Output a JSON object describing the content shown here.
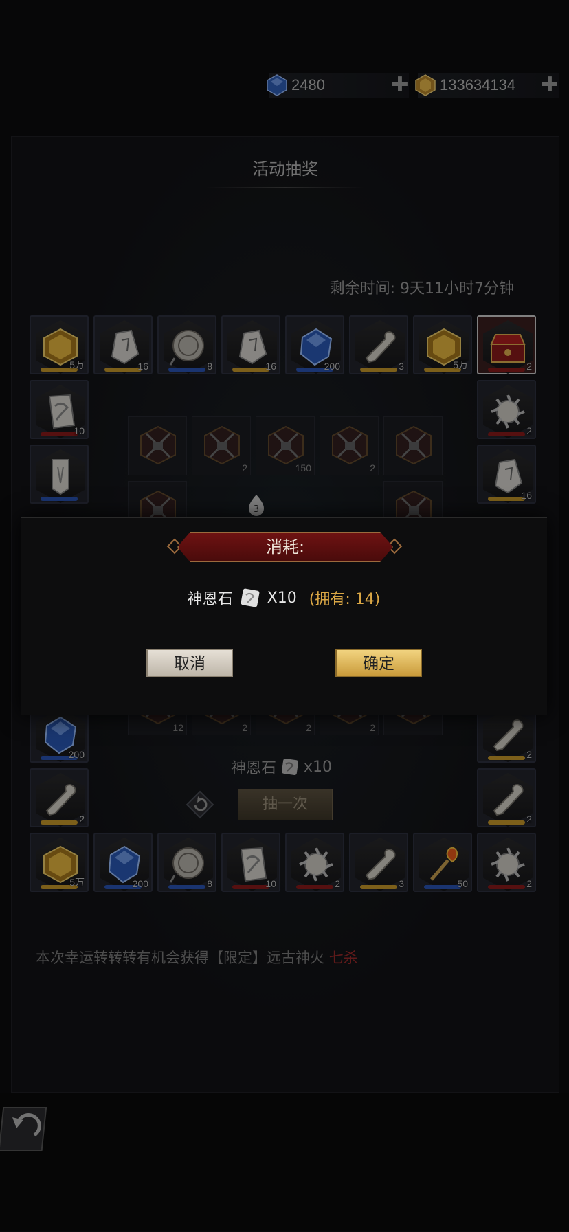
{
  "currency": {
    "diamond_value": "2480",
    "gold_value": "133634134",
    "plus": "✚"
  },
  "title": "活动抽奖",
  "remaining_time": "剩余时间: 9天11小时7分钟",
  "grid": {
    "top_row": [
      {
        "item": "gold-crystal",
        "qty": "5万",
        "rarity": "gold"
      },
      {
        "item": "white-rune-stone",
        "qty": "16",
        "rarity": "gold"
      },
      {
        "item": "compass-amulet",
        "qty": "8",
        "rarity": "blue"
      },
      {
        "item": "white-rune-stone",
        "qty": "16",
        "rarity": "gold"
      },
      {
        "item": "blue-crystal",
        "qty": "200",
        "rarity": "blue"
      },
      {
        "item": "bone-club",
        "qty": "3",
        "rarity": "gold"
      },
      {
        "item": "gold-crystal",
        "qty": "5万",
        "rarity": "gold"
      },
      {
        "item": "crimson-chest",
        "qty": "2",
        "rarity": "red"
      }
    ],
    "left_col": [
      {
        "item": "rune-scroll",
        "qty": "10",
        "rarity": "red"
      },
      {
        "item": "white-banner",
        "qty": "",
        "rarity": "blue"
      }
    ],
    "right_col": [
      {
        "item": "spiked-shell",
        "qty": "2",
        "rarity": "red"
      },
      {
        "item": "white-rune-stone",
        "qty": "16",
        "rarity": "gold"
      }
    ],
    "left_col_lower": [
      {
        "item": "blue-crystal",
        "qty": "200",
        "rarity": "blue"
      },
      {
        "item": "bone-club",
        "qty": "2",
        "rarity": "gold"
      }
    ],
    "right_col_lower": [
      {
        "item": "bone-club",
        "qty": "2",
        "rarity": "gold"
      },
      {
        "item": "bone-club",
        "qty": "2",
        "rarity": "gold"
      }
    ],
    "bottom_row": [
      {
        "item": "gold-crystal",
        "qty": "5万",
        "rarity": "gold"
      },
      {
        "item": "blue-crystal",
        "qty": "200",
        "rarity": "blue"
      },
      {
        "item": "compass-amulet",
        "qty": "8",
        "rarity": "blue"
      },
      {
        "item": "rune-scroll",
        "qty": "10",
        "rarity": "red"
      },
      {
        "item": "spiked-shell",
        "qty": "2",
        "rarity": "red"
      },
      {
        "item": "bone-club",
        "qty": "3",
        "rarity": "gold"
      },
      {
        "item": "flame-torch",
        "qty": "50",
        "rarity": "blue"
      },
      {
        "item": "spiked-shell",
        "qty": "2",
        "rarity": "red"
      }
    ],
    "inner_top": [
      "",
      "2",
      "150",
      "2",
      ""
    ],
    "inner_bottom": [
      "12",
      "2",
      "2",
      "2",
      ""
    ],
    "center_badge": "3"
  },
  "cost": {
    "item": "神恩石",
    "amount": "x10"
  },
  "draw_button": "抽一次",
  "footer_note": {
    "text": "本次幸运转转转有机会获得【限定】远古神火",
    "highlight": "七杀"
  },
  "modal": {
    "header": "消耗:",
    "item_name": "神恩石",
    "amount": "X10",
    "owned": "(拥有: 14)",
    "cancel": "取消",
    "confirm": "确定"
  },
  "colors": {
    "gold": "#c99a2a",
    "blue": "#2a55b5",
    "red": "#8a1a1a",
    "accent_red": "#6e1212"
  }
}
